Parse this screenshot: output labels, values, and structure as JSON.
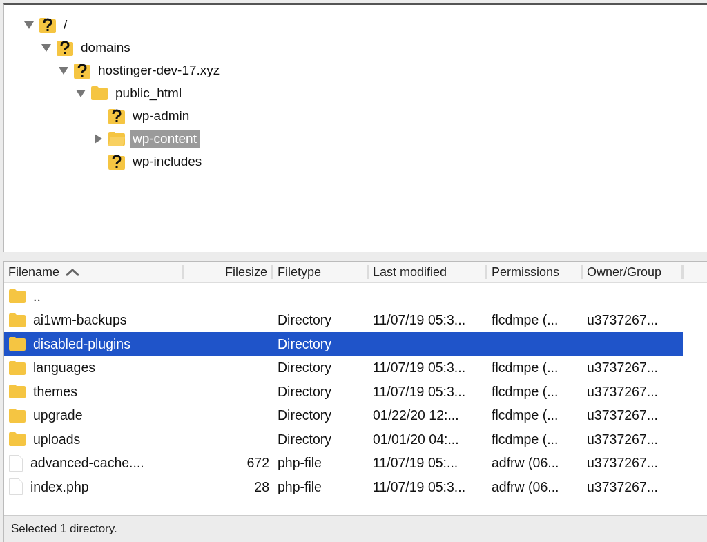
{
  "tree": [
    {
      "label": "/",
      "kind": "unknown",
      "expanded": true,
      "selected": false,
      "children": [
        {
          "label": "domains",
          "kind": "unknown",
          "expanded": true,
          "selected": false,
          "children": [
            {
              "label": "hostinger-dev-17.xyz",
              "kind": "unknown",
              "expanded": true,
              "selected": false,
              "children": [
                {
                  "label": "public_html",
                  "kind": "folder",
                  "expanded": true,
                  "selected": false,
                  "children": [
                    {
                      "label": "wp-admin",
                      "kind": "unknown",
                      "selected": false
                    },
                    {
                      "label": "wp-content",
                      "kind": "folder",
                      "expanded": false,
                      "selected": true
                    },
                    {
                      "label": "wp-includes",
                      "kind": "unknown",
                      "selected": false
                    }
                  ]
                }
              ]
            }
          ]
        }
      ]
    }
  ],
  "table": {
    "columns": [
      {
        "label": "Filename",
        "sorted": true
      },
      {
        "label": "Filesize",
        "sorted": false
      },
      {
        "label": "Filetype",
        "sorted": false
      },
      {
        "label": "Last modified",
        "sorted": false
      },
      {
        "label": "Permissions",
        "sorted": false
      },
      {
        "label": "Owner/Group",
        "sorted": false
      }
    ],
    "rows": [
      {
        "kind": "folder",
        "name": "..",
        "selected": false
      },
      {
        "kind": "folder",
        "name": "ai1wm-backups",
        "type": "Directory",
        "modified": "11/07/19 05:3...",
        "permissions": "flcdmpe (...",
        "owner": "u3737267...",
        "selected": false
      },
      {
        "kind": "folder",
        "name": "disabled-plugins",
        "type": "Directory",
        "selected": true
      },
      {
        "kind": "folder",
        "name": "languages",
        "type": "Directory",
        "modified": "11/07/19 05:3...",
        "permissions": "flcdmpe (...",
        "owner": "u3737267...",
        "selected": false
      },
      {
        "kind": "folder",
        "name": "themes",
        "type": "Directory",
        "modified": "11/07/19 05:3...",
        "permissions": "flcdmpe (...",
        "owner": "u3737267...",
        "selected": false
      },
      {
        "kind": "folder",
        "name": "upgrade",
        "type": "Directory",
        "modified": "01/22/20 12:...",
        "permissions": "flcdmpe (...",
        "owner": "u3737267...",
        "selected": false
      },
      {
        "kind": "folder",
        "name": "uploads",
        "type": "Directory",
        "modified": "01/01/20 04:...",
        "permissions": "flcdmpe (...",
        "owner": "u3737267...",
        "selected": false
      },
      {
        "kind": "file",
        "name": "advanced-cache....",
        "size": "672",
        "type": "php-file",
        "modified": "11/07/19 05:...",
        "permissions": "adfrw (06...",
        "owner": "u3737267...",
        "selected": false
      },
      {
        "kind": "file",
        "name": "index.php",
        "size": "28",
        "type": "php-file",
        "modified": "11/07/19 05:3...",
        "permissions": "adfrw (06...",
        "owner": "u3737267...",
        "selected": false
      }
    ]
  },
  "status_bar": "Selected 1 directory."
}
